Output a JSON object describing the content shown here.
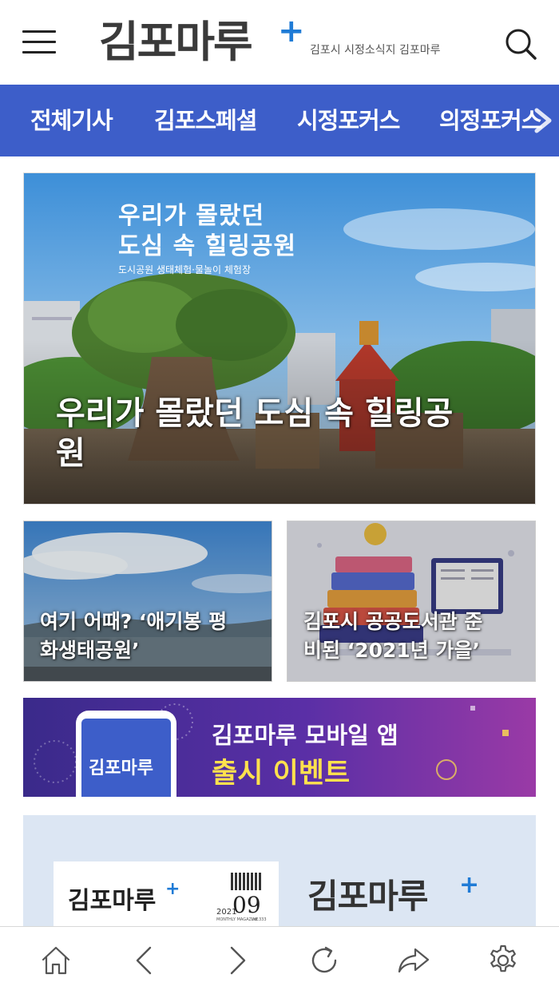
{
  "header": {
    "logo_text": "김포마루",
    "tagline": "김포시 시정소식지 김포마루"
  },
  "nav": {
    "items": [
      "전체기사",
      "김포스페셜",
      "시정포커스",
      "의정포커스"
    ]
  },
  "hero": {
    "poster_line1": "우리가 몰랐던",
    "poster_line2": "도심 속 힐링공원",
    "poster_sub": "도시공원 생태체험·물놀이 체험장",
    "title_line1": "우리가 몰랐던 도심 속 힐링공",
    "title_line2": "원"
  },
  "cards": [
    {
      "title_line1": "여기 어때? ‘애기봉 평",
      "title_line2": "화생태공원’"
    },
    {
      "title_line1": "김포시 공공도서관 준",
      "title_line2": "비된 ‘2021년 가을’"
    }
  ],
  "banner": {
    "phone_logo": "김포마루",
    "line1": "김포마루 모바일 앱",
    "line2": "출시 이벤트"
  },
  "magazine": {
    "cover_logo": "김포마루",
    "cover_year": "2021",
    "cover_issue": "09",
    "cover_sub": "MONTHLY MAGAZINE",
    "cover_vol": "vol.333",
    "brand_logo": "김포마루"
  },
  "colors": {
    "nav_bg": "#3d5ec9",
    "logo_plus": "#1f7bd6",
    "banner_bg": "#4b2ea0",
    "banner_yellow": "#ffe14d"
  },
  "icons": [
    "menu-icon",
    "search-icon",
    "chevron-right-icon",
    "home-icon",
    "back-icon",
    "forward-icon",
    "refresh-icon",
    "share-icon",
    "settings-icon"
  ]
}
